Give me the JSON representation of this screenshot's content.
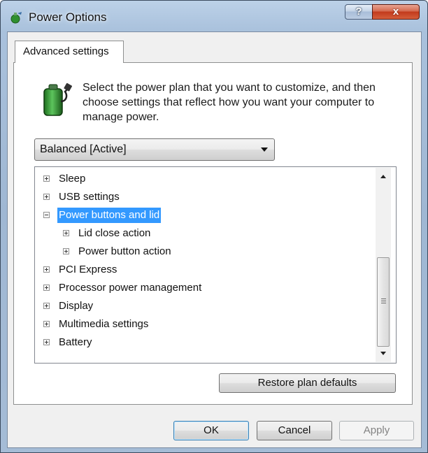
{
  "window": {
    "title": "Power Options",
    "help_label": "?",
    "close_label": "x"
  },
  "tab": {
    "label": "Advanced settings"
  },
  "description": "Select the power plan that you want to customize, and then choose settings that reflect how you want your computer to manage power.",
  "plan_select": {
    "value": "Balanced [Active]"
  },
  "tree": {
    "items": [
      {
        "label": "Sleep",
        "expanded": false,
        "level": 0,
        "selected": false
      },
      {
        "label": "USB settings",
        "expanded": false,
        "level": 0,
        "selected": false
      },
      {
        "label": "Power buttons and lid",
        "expanded": true,
        "level": 0,
        "selected": true
      },
      {
        "label": "Lid close action",
        "expanded": false,
        "level": 1,
        "selected": false
      },
      {
        "label": "Power button action",
        "expanded": false,
        "level": 1,
        "selected": false
      },
      {
        "label": "PCI Express",
        "expanded": false,
        "level": 0,
        "selected": false
      },
      {
        "label": "Processor power management",
        "expanded": false,
        "level": 0,
        "selected": false
      },
      {
        "label": "Display",
        "expanded": false,
        "level": 0,
        "selected": false
      },
      {
        "label": "Multimedia settings",
        "expanded": false,
        "level": 0,
        "selected": false
      },
      {
        "label": "Battery",
        "expanded": false,
        "level": 0,
        "selected": false
      }
    ]
  },
  "buttons": {
    "restore": "Restore plan defaults",
    "ok": "OK",
    "cancel": "Cancel",
    "apply": "Apply"
  },
  "colors": {
    "selection": "#3399ff",
    "titlebar": "#a9c1dc",
    "close_button": "#c23a1c"
  },
  "icons": {
    "window": "power-options-icon",
    "plan": "battery-plug-icon",
    "dropdown": "chevron-down-icon"
  }
}
